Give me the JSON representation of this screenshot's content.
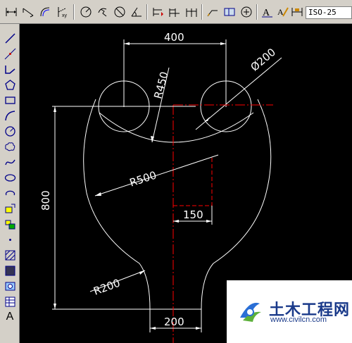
{
  "toolbar": {
    "dim_style": "ISO-25",
    "buttons": [
      "dim-linear",
      "dim-aligned",
      "dim-arc",
      "dim-ordinate",
      "dim-radius",
      "dim-jogged",
      "dim-diameter",
      "dim-angular",
      "dim-quick",
      "dim-baseline",
      "dim-continue",
      "dim-leader",
      "tolerance",
      "center-mark",
      "dim-edit",
      "dim-text-edit",
      "dim-update"
    ]
  },
  "drawing_toolbar": {
    "tools": [
      "line",
      "construction-line",
      "polyline",
      "polygon",
      "rectangle",
      "arc",
      "circle",
      "revision-cloud",
      "spline",
      "ellipse",
      "ellipse-arc",
      "insert-block",
      "make-block",
      "point",
      "hatch",
      "gradient",
      "region",
      "table",
      "multiline-text"
    ],
    "text_tool_label": "A"
  },
  "drawing": {
    "dim_top": "400",
    "dim_diameter": "Ø200",
    "dim_r450": "R450",
    "dim_r500": "R500",
    "dim_height": "800",
    "dim_inner": "150",
    "dim_r200": "R200",
    "dim_bottom": "200",
    "colors": {
      "background": "#000000",
      "lines": "#ffffff",
      "centerline": "#ff0000"
    }
  },
  "watermark": {
    "title": "土木工程网",
    "url": "www.civilcn.com"
  }
}
